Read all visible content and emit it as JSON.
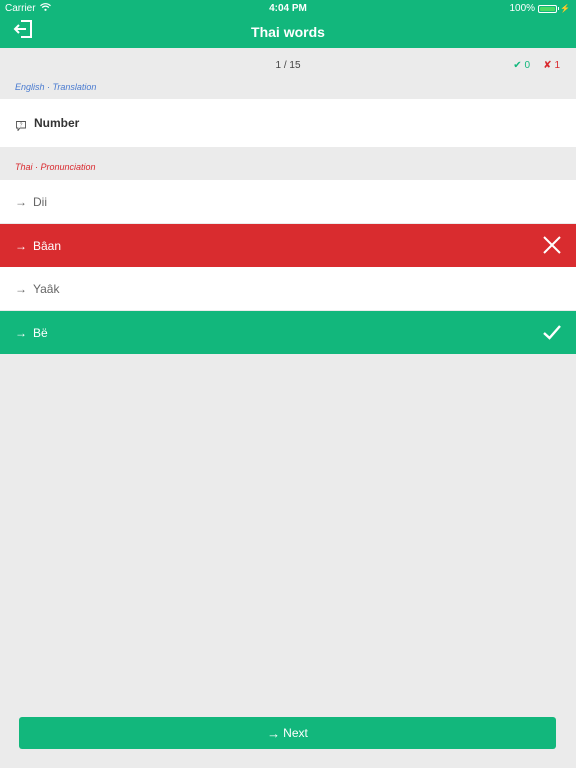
{
  "status_bar": {
    "carrier": "Carrier",
    "time": "4:04 PM",
    "battery_percent": "100%",
    "wifi_icon": "wifi-icon",
    "battery_icon": "battery-icon",
    "charging_icon": "lightning-icon"
  },
  "nav": {
    "title": "Thai words",
    "back_icon": "exit-icon"
  },
  "progress": {
    "text": "1 / 15",
    "correct_count": "✔ 0",
    "wrong_count": "✘ 1"
  },
  "question": {
    "section_label": "English · Translation",
    "icon": "question-bubble-icon",
    "text": "Number"
  },
  "answers": {
    "section_label": "Thai · Pronunciation",
    "items": [
      {
        "arrow": "→",
        "text": "Dii",
        "state": "neutral"
      },
      {
        "arrow": "→",
        "text": "Bâan",
        "state": "wrong"
      },
      {
        "arrow": "→",
        "text": "Yaâk",
        "state": "neutral"
      },
      {
        "arrow": "→",
        "text": "Bë",
        "state": "correct"
      }
    ]
  },
  "footer": {
    "next_arrow": "→",
    "next_label": "Next"
  },
  "colors": {
    "primary_green": "#12b77c",
    "error_red": "#d92c2f",
    "english_label": "#4a7bd0",
    "thai_label": "#d9292e",
    "background": "#ebebeb"
  }
}
